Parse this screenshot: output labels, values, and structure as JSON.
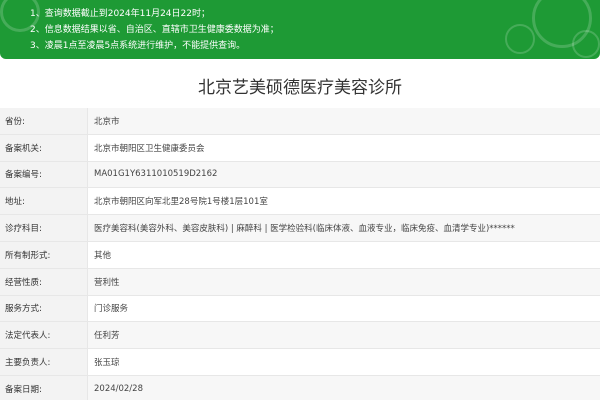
{
  "notice": {
    "lines": [
      "1、查询数据截止到2024年11月24日22时；",
      "2、信息数据结果以省、自治区、直辖市卫生健康委数据为准；",
      "3、凌晨1点至凌晨5点系统进行维护，不能提供查询。"
    ]
  },
  "title": "北京艺美硕德医疗美容诊所",
  "rows": [
    {
      "label": "省份:",
      "value": "北京市"
    },
    {
      "label": "备案机关:",
      "value": "北京市朝阳区卫生健康委员会"
    },
    {
      "label": "备案编号:",
      "value": "MA01G1Y6311010519D2162"
    },
    {
      "label": "地址:",
      "value": "北京市朝阳区向军北里28号院1号楼1层101室"
    },
    {
      "label": "诊疗科目:",
      "value": "医疗美容科(美容外科、美容皮肤科) | 麻醉科 | 医学检验科(临床体液、血液专业，临床免疫、血清学专业)******"
    },
    {
      "label": "所有制形式:",
      "value": "其他"
    },
    {
      "label": "经营性质:",
      "value": "营利性"
    },
    {
      "label": "服务方式:",
      "value": "门诊服务"
    },
    {
      "label": "法定代表人:",
      "value": "任利芳"
    },
    {
      "label": "主要负责人:",
      "value": "张玉琼"
    },
    {
      "label": "备案日期:",
      "value": "2024/02/28"
    }
  ]
}
